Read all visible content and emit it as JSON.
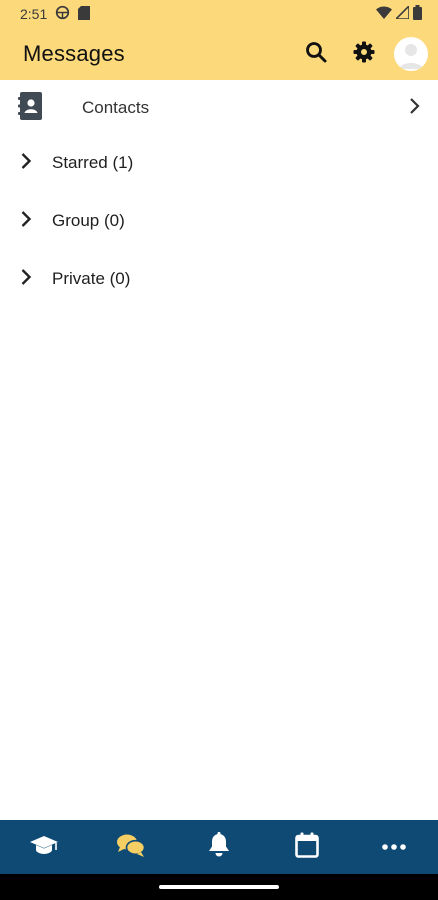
{
  "status_bar": {
    "time": "2:51"
  },
  "app_bar": {
    "title": "Messages",
    "actions": [
      "search-icon",
      "gear-icon",
      "avatar"
    ]
  },
  "contacts": {
    "label": "Contacts"
  },
  "sections": [
    {
      "label": "Starred (1)"
    },
    {
      "label": "Group (0)"
    },
    {
      "label": "Private (0)"
    }
  ],
  "bottom_nav": {
    "items": [
      "graduation-cap-icon",
      "chat-bubbles-icon",
      "bell-icon",
      "calendar-icon",
      "more-icon"
    ],
    "active_index": 1
  },
  "colors": {
    "header_bg": "#fcd97a",
    "nav_bg": "#0e4a74",
    "active_icon": "#f5cf63",
    "text": "#1f1f1f"
  }
}
